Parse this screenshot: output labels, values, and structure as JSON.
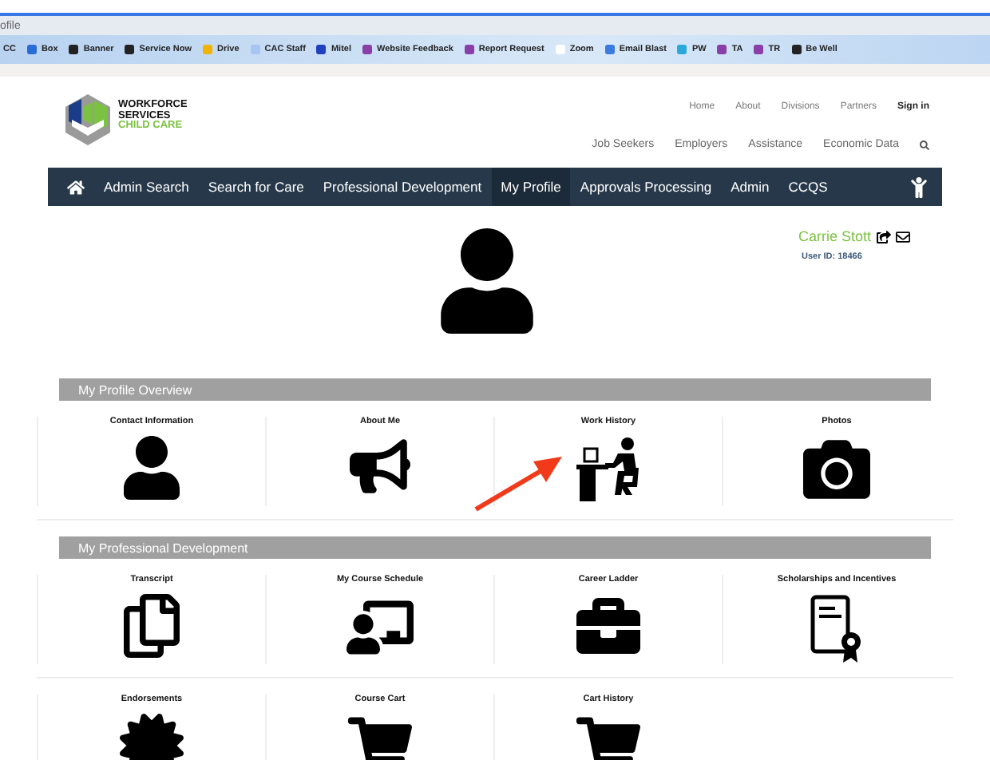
{
  "browser": {
    "tab_title": "ofile",
    "bookmarks": [
      {
        "label": "CC"
      },
      {
        "label": "Box",
        "color": "#2a6bd8"
      },
      {
        "label": "Banner",
        "color": "#222222"
      },
      {
        "label": "Service Now",
        "color": "#222222"
      },
      {
        "label": "Drive",
        "color": "#f2b400"
      },
      {
        "label": "CAC Staff",
        "color": "#a8c4f0"
      },
      {
        "label": "Mitel",
        "color": "#2040c0"
      },
      {
        "label": "Website Feedback",
        "color": "#8a3fa8"
      },
      {
        "label": "Report Request",
        "color": "#8a3fa8"
      },
      {
        "label": "Zoom",
        "color": "#ffffff"
      },
      {
        "label": "Email Blast",
        "color": "#3a7be0"
      },
      {
        "label": "PW",
        "color": "#2aa8d8"
      },
      {
        "label": "TA",
        "color": "#8a3fa8"
      },
      {
        "label": "TR",
        "color": "#8a3fa8"
      },
      {
        "label": "Be Well",
        "color": "#222222"
      }
    ]
  },
  "logo": {
    "line1": "WORKFORCE",
    "line2": "SERVICES",
    "line3": "CHILD CARE"
  },
  "top_links": [
    {
      "label": "Home",
      "kind": "link"
    },
    {
      "label": "About",
      "kind": "link"
    },
    {
      "label": "Divisions",
      "kind": "link"
    },
    {
      "label": "Partners",
      "kind": "link"
    },
    {
      "label": "Sign in",
      "kind": "strong"
    }
  ],
  "secondary_links": [
    "Job Seekers",
    "Employers",
    "Assistance",
    "Economic Data"
  ],
  "nav": [
    {
      "label": "Admin Search",
      "selected": false
    },
    {
      "label": "Search for Care",
      "selected": false
    },
    {
      "label": "Professional Development",
      "selected": false
    },
    {
      "label": "My Profile",
      "selected": true
    },
    {
      "label": "Approvals Processing",
      "selected": false
    },
    {
      "label": "Admin",
      "selected": false
    },
    {
      "label": "CCQS",
      "selected": false
    }
  ],
  "profile": {
    "name": "Carrie Stott",
    "user_id": "User ID: 18466"
  },
  "sections": [
    {
      "title": "My Profile Overview",
      "rows": [
        [
          {
            "label": "Contact Information",
            "kind": "person"
          },
          {
            "label": "About Me",
            "kind": "megaphone"
          },
          {
            "label": "Work History",
            "kind": "desk"
          },
          {
            "label": "Photos",
            "kind": "camera"
          }
        ]
      ]
    },
    {
      "title": "My Professional Development",
      "rows": [
        [
          {
            "label": "Transcript",
            "kind": "document"
          },
          {
            "label": "My Course Schedule",
            "kind": "classroom"
          },
          {
            "label": "Career Ladder",
            "kind": "briefcase"
          },
          {
            "label": "Scholarships and Incentives",
            "kind": "certificate"
          }
        ],
        [
          {
            "label": "Endorsements",
            "kind": "badge"
          },
          {
            "label": "Course Cart",
            "kind": "cart"
          },
          {
            "label": "Cart History",
            "kind": "cart"
          }
        ]
      ]
    }
  ]
}
